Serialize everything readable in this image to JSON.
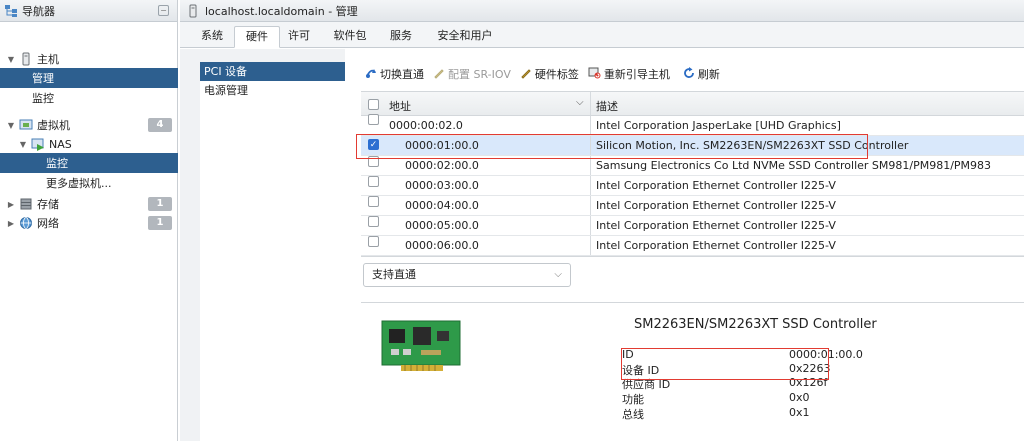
{
  "navigator": {
    "title": "导航器",
    "items": [
      {
        "label": "主机"
      },
      {
        "label": "管理"
      },
      {
        "label": "监控"
      },
      {
        "label": "虚拟机",
        "badge": "4"
      },
      {
        "label": "NAS"
      },
      {
        "label": "监控"
      },
      {
        "label": "更多虚拟机..."
      },
      {
        "label": "存储",
        "badge": "1"
      },
      {
        "label": "网络",
        "badge": "1"
      }
    ]
  },
  "window": {
    "title": "localhost.localdomain - 管理",
    "tabs": [
      "系统",
      "硬件",
      "许可",
      "软件包",
      "服务",
      "安全和用户"
    ],
    "active_tab": "硬件"
  },
  "side_menu": [
    "PCI 设备",
    "电源管理"
  ],
  "toolbar": {
    "toggle_passthrough": "切换直通",
    "configure_sriov": "配置 SR-IOV",
    "hardware_label": "硬件标签",
    "reboot_host": "重新引导主机",
    "refresh": "刷新"
  },
  "table": {
    "col_address": "地址",
    "col_description": "描述",
    "rows": [
      {
        "address": "0000:00:02.0",
        "description": "Intel Corporation JasperLake [UHD Graphics]",
        "checked": false
      },
      {
        "address": "0000:01:00.0",
        "description": "Silicon Motion, Inc. SM2263EN/SM2263XT SSD Controller",
        "checked": true
      },
      {
        "address": "0000:02:00.0",
        "description": "Samsung Electronics Co Ltd NVMe SSD Controller SM981/PM981/PM983",
        "checked": false
      },
      {
        "address": "0000:03:00.0",
        "description": "Intel Corporation Ethernet Controller I225-V",
        "checked": false
      },
      {
        "address": "0000:04:00.0",
        "description": "Intel Corporation Ethernet Controller I225-V",
        "checked": false
      },
      {
        "address": "0000:05:00.0",
        "description": "Intel Corporation Ethernet Controller I225-V",
        "checked": false
      },
      {
        "address": "0000:06:00.0",
        "description": "Intel Corporation Ethernet Controller I225-V",
        "checked": false
      }
    ],
    "filter_value": "支持直通"
  },
  "details": {
    "title": "SM2263EN/SM2263XT SSD Controller",
    "fields": [
      {
        "key": "ID",
        "value": "0000:01:00.0"
      },
      {
        "key": "设备 ID",
        "value": "0x2263"
      },
      {
        "key": "供应商 ID",
        "value": "0x126f"
      },
      {
        "key": "功能",
        "value": "0x0"
      },
      {
        "key": "总线",
        "value": "0x1"
      }
    ]
  },
  "colors": {
    "selection": "#2d5f8f",
    "row_highlight": "#d9e8fb",
    "annotation": "#e23b32"
  }
}
